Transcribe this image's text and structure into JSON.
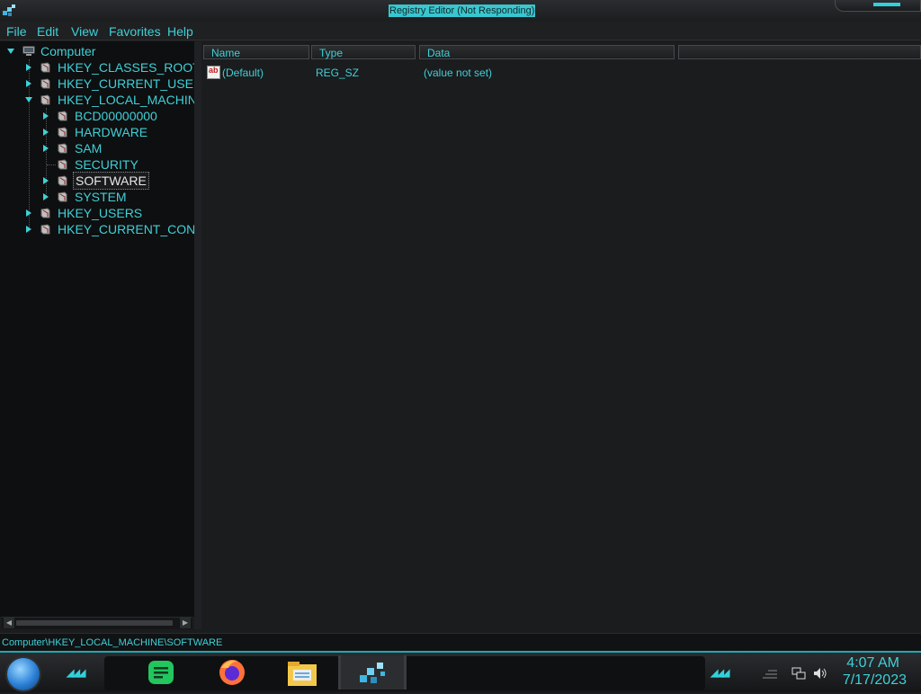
{
  "window": {
    "title": "Registry Editor (Not Responding)"
  },
  "menu": {
    "items": [
      "File",
      "Edit",
      "View",
      "Favorites",
      "Help"
    ]
  },
  "tree": {
    "root": "Computer",
    "nodes": [
      {
        "label": "HKEY_CLASSES_ROOT",
        "depth": 1,
        "expander": "collapsed"
      },
      {
        "label": "HKEY_CURRENT_USER",
        "depth": 1,
        "expander": "collapsed"
      },
      {
        "label": "HKEY_LOCAL_MACHINE",
        "depth": 1,
        "expander": "expanded"
      },
      {
        "label": "BCD00000000",
        "depth": 2,
        "expander": "collapsed"
      },
      {
        "label": "HARDWARE",
        "depth": 2,
        "expander": "collapsed"
      },
      {
        "label": "SAM",
        "depth": 2,
        "expander": "collapsed"
      },
      {
        "label": "SECURITY",
        "depth": 2,
        "expander": "none"
      },
      {
        "label": "SOFTWARE",
        "depth": 2,
        "expander": "collapsed",
        "selected": true
      },
      {
        "label": "SYSTEM",
        "depth": 2,
        "expander": "collapsed"
      },
      {
        "label": "HKEY_USERS",
        "depth": 1,
        "expander": "collapsed"
      },
      {
        "label": "HKEY_CURRENT_CONFI",
        "depth": 1,
        "expander": "collapsed"
      }
    ]
  },
  "list": {
    "columns": [
      "Name",
      "Type",
      "Data"
    ],
    "rows": [
      {
        "name": "(Default)",
        "type": "REG_SZ",
        "data": "(value not set)",
        "icon": "string-value-icon"
      }
    ]
  },
  "statusbar": {
    "path": "Computer\\HKEY_LOCAL_MACHINE\\SOFTWARE"
  },
  "taskbar": {
    "apps": [
      {
        "name": "notes-app-icon",
        "color": "#22c55e"
      },
      {
        "name": "firefox-icon",
        "color": "#ff7139"
      },
      {
        "name": "file-explorer-icon",
        "color": "#f3c84a"
      },
      {
        "name": "registry-editor-icon",
        "color": "#3fb6e0",
        "active": true
      }
    ],
    "clock": {
      "time": "4:07 AM",
      "date": "7/17/2023"
    }
  },
  "colors": {
    "accent": "#3fd0d8",
    "background": "#1b1c1e",
    "tree_background": "#0e0f10"
  }
}
